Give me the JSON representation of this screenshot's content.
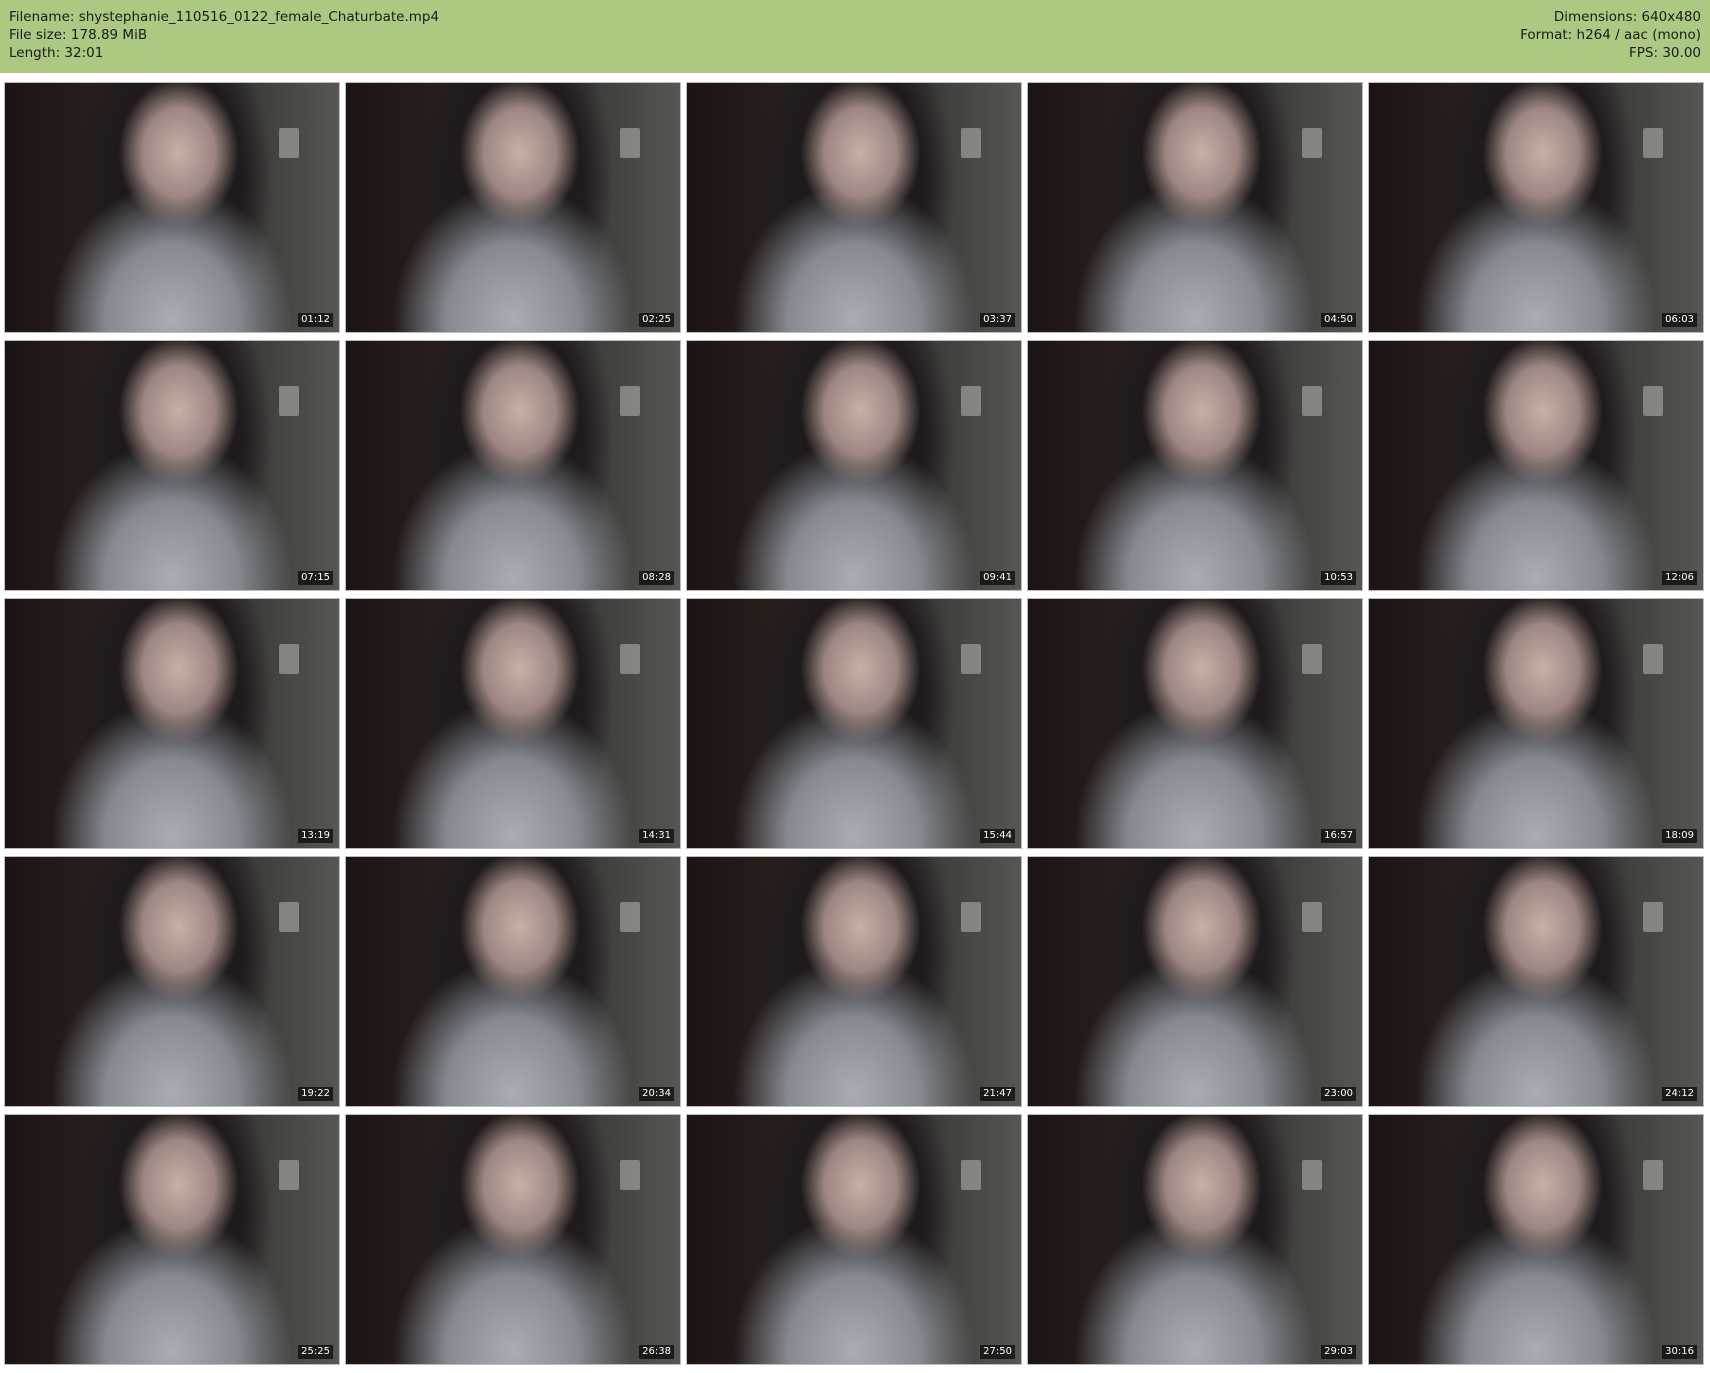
{
  "header": {
    "filename": "Filename: shystephanie_110516_0122_female_Chaturbate.mp4",
    "filesize": "File size: 178.89 MiB",
    "length": "Length: 32:01",
    "dimensions": "Dimensions: 640x480",
    "format": "Format: h264 / aac (mono)",
    "fps": "FPS: 30.00"
  },
  "thumbnails": [
    {
      "time": "01:12"
    },
    {
      "time": "02:25"
    },
    {
      "time": "03:37"
    },
    {
      "time": "04:50"
    },
    {
      "time": "06:03"
    },
    {
      "time": "07:15"
    },
    {
      "time": "08:28"
    },
    {
      "time": "09:41"
    },
    {
      "time": "10:53"
    },
    {
      "time": "12:06"
    },
    {
      "time": "13:19"
    },
    {
      "time": "14:31"
    },
    {
      "time": "15:44"
    },
    {
      "time": "16:57"
    },
    {
      "time": "18:09"
    },
    {
      "time": "19:22"
    },
    {
      "time": "20:34"
    },
    {
      "time": "21:47"
    },
    {
      "time": "23:00"
    },
    {
      "time": "24:12"
    },
    {
      "time": "25:25"
    },
    {
      "time": "26:38"
    },
    {
      "time": "27:50"
    },
    {
      "time": "29:03"
    },
    {
      "time": "30:16"
    }
  ],
  "colors": {
    "header_bg": "#abc981",
    "page_bg": "#ffffff",
    "timestamp_bg": "#000000"
  }
}
